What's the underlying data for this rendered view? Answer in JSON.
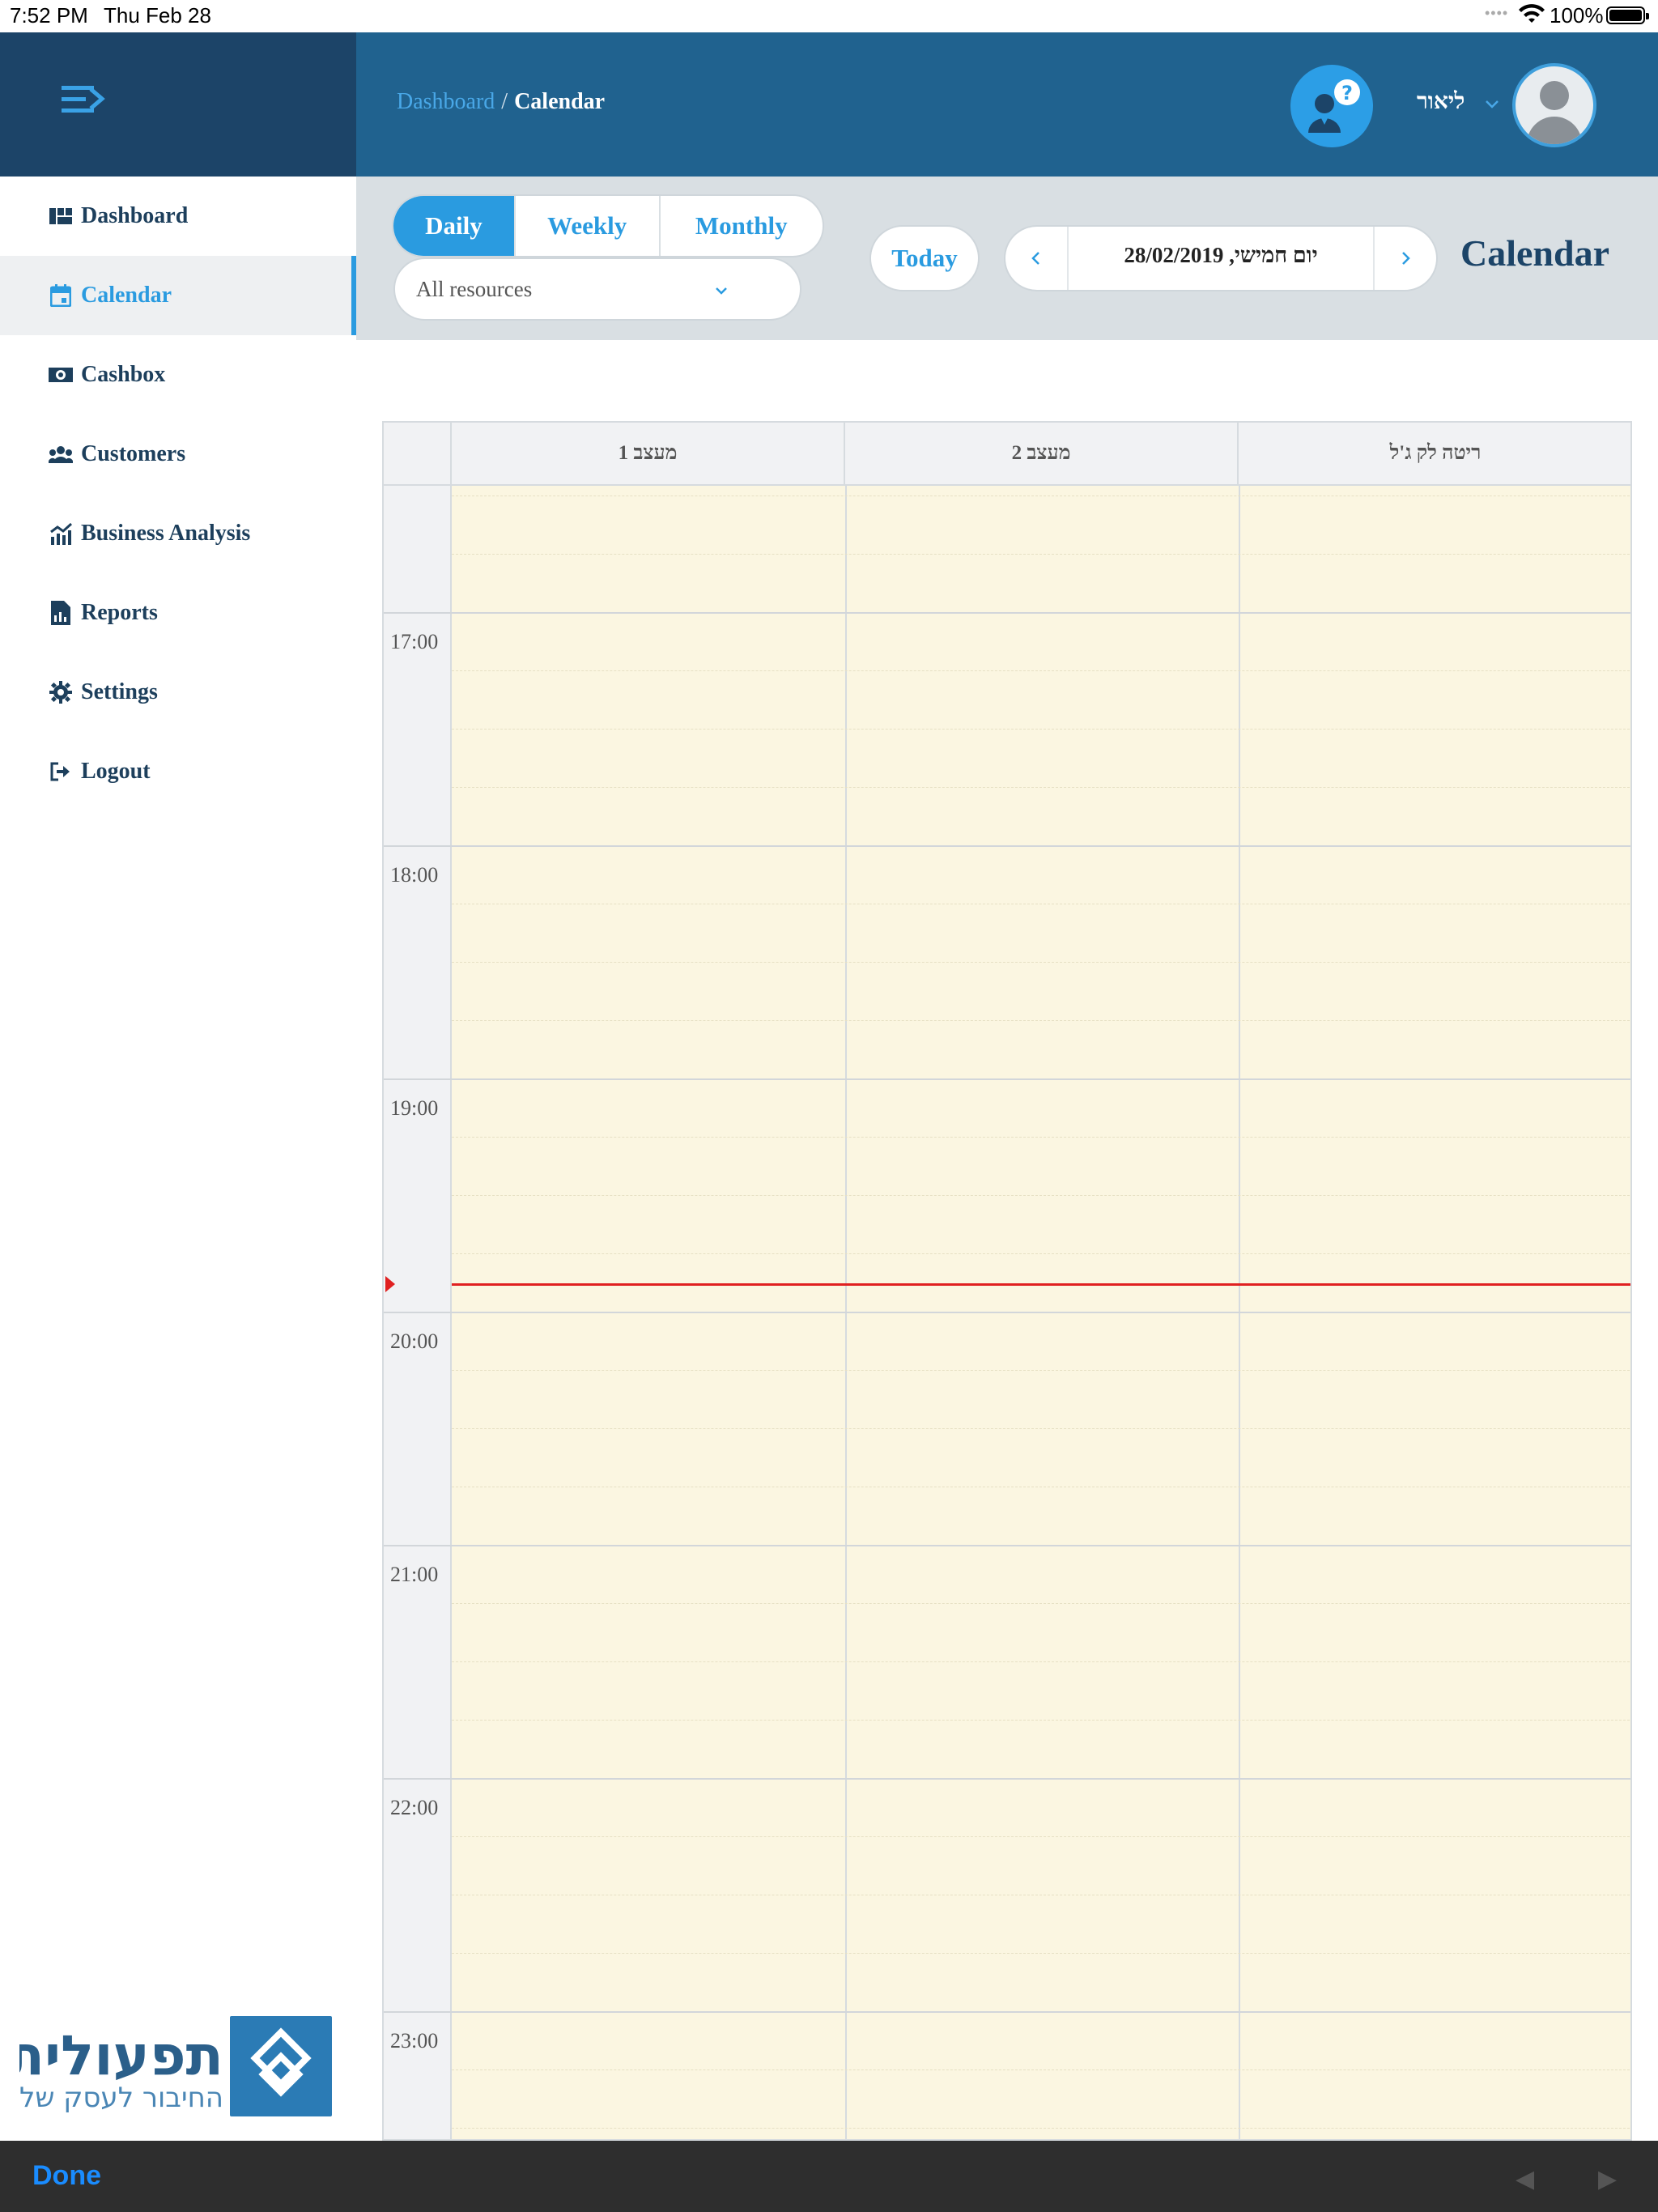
{
  "status_bar": {
    "time": "7:52 PM",
    "date": "Thu Feb 28",
    "battery": "100%"
  },
  "header": {
    "breadcrumb": {
      "parent": "Dashboard",
      "separator": "/",
      "current": "Calendar"
    },
    "user_name": "ליאור"
  },
  "sidebar": {
    "items": [
      {
        "label": "Dashboard",
        "icon": "dashboard-icon"
      },
      {
        "label": "Calendar",
        "icon": "calendar-icon",
        "active": true
      },
      {
        "label": "Cashbox",
        "icon": "cash-icon"
      },
      {
        "label": "Customers",
        "icon": "users-icon"
      },
      {
        "label": "Business Analysis",
        "icon": "chart-icon"
      },
      {
        "label": "Reports",
        "icon": "report-icon"
      },
      {
        "label": "Settings",
        "icon": "gear-icon"
      },
      {
        "label": "Logout",
        "icon": "logout-icon"
      }
    ],
    "logo": {
      "name": "תפעולית",
      "tagline": "החיבור לעסק שלך"
    }
  },
  "toolbar": {
    "views": [
      "Daily",
      "Weekly",
      "Monthly"
    ],
    "active_view": "Daily",
    "resources_selected": "All resources",
    "today_label": "Today",
    "date_display": "יום חמישי, 28/02/2019",
    "page_title": "Calendar"
  },
  "calendar": {
    "columns": [
      "מעצב 1",
      "מעצב 2",
      "ריטה לק ג'ל"
    ],
    "hour_labels": [
      "17:00",
      "18:00",
      "19:00",
      "20:00",
      "21:00",
      "22:00",
      "23:00"
    ],
    "current_time": "19:52"
  },
  "bottom_bar": {
    "done_label": "Done"
  },
  "colors": {
    "sidebar_top": "#1c4468",
    "header": "#20628f",
    "accent": "#2a9be0",
    "slot_background": "#fbf6e1",
    "now_line": "#e02020"
  }
}
